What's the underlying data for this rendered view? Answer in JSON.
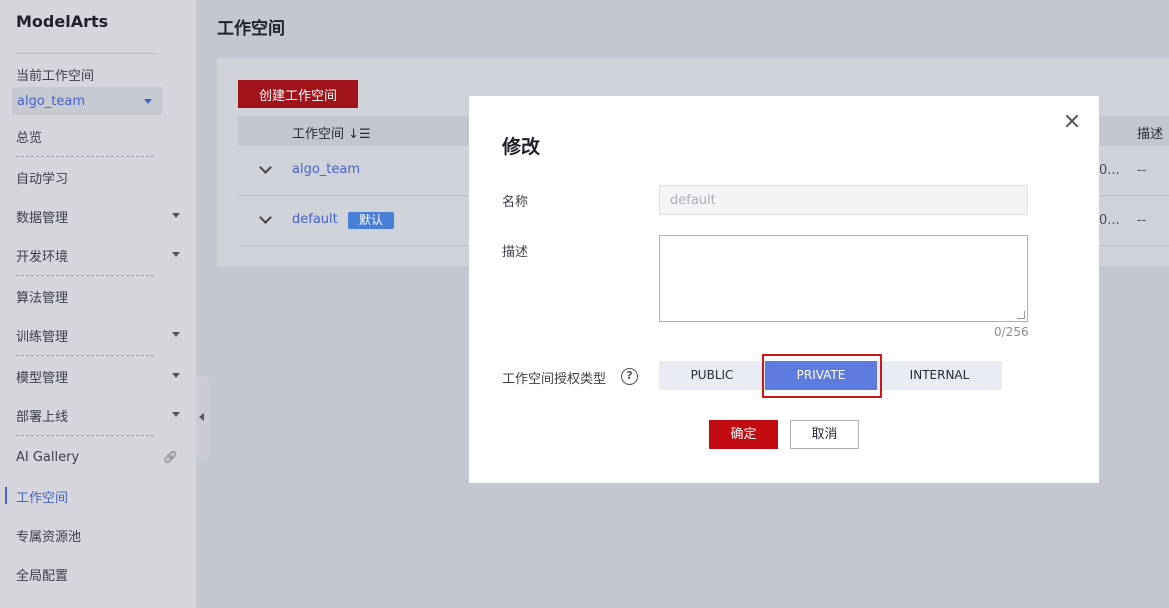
{
  "sidebar": {
    "brand": "ModelArts",
    "workspace_label": "当前工作空间",
    "workspace_value": "algo_team",
    "items": [
      {
        "label": "总览"
      },
      {
        "label": "自动学习"
      },
      {
        "label": "数据管理"
      },
      {
        "label": "开发环境"
      },
      {
        "label": "算法管理"
      },
      {
        "label": "训练管理"
      },
      {
        "label": "模型管理"
      },
      {
        "label": "部署上线"
      },
      {
        "label": "AI Gallery"
      },
      {
        "label": "工作空间"
      },
      {
        "label": "专属资源池"
      },
      {
        "label": "全局配置"
      }
    ]
  },
  "main": {
    "title": "工作空间",
    "create_button": "创建工作空间",
    "columns": {
      "name": "工作空间",
      "desc": "描述"
    },
    "rows": [
      {
        "name": "algo_team",
        "col_partial": "0...",
        "desc": "--"
      },
      {
        "name": "default",
        "tag": "默认",
        "col_partial": "0...",
        "desc": "--"
      }
    ]
  },
  "modal": {
    "title": "修改",
    "name_label": "名称",
    "name_placeholder": "default",
    "desc_label": "描述",
    "desc_counter": "0/256",
    "auth_label": "工作空间授权类型",
    "auth_options": [
      "PUBLIC",
      "PRIVATE",
      "INTERNAL"
    ],
    "auth_selected": "PRIVATE",
    "confirm": "确定",
    "cancel": "取消"
  },
  "colors": {
    "brand_red": "#c20a11",
    "accent_blue": "#5e7ce0",
    "highlight": "#d1161a"
  }
}
